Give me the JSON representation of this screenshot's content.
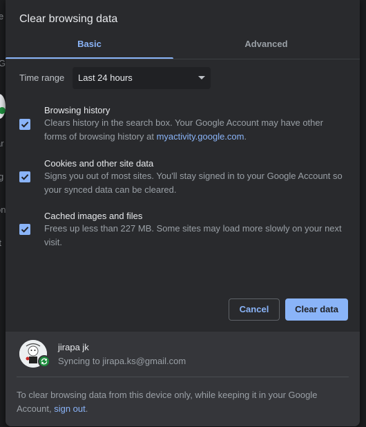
{
  "dialog": {
    "title": "Clear browsing data",
    "tabs": [
      {
        "label": "Basic",
        "selected": true
      },
      {
        "label": "Advanced",
        "selected": false
      }
    ],
    "time_range": {
      "label": "Time range",
      "value": "Last 24 hours"
    },
    "items": [
      {
        "title": "Browsing history",
        "checked": true,
        "desc_before": "Clears history in the search box. Your Google Account may have other forms of browsing history at ",
        "desc_link": "myactivity.google.com",
        "desc_after": "."
      },
      {
        "title": "Cookies and other site data",
        "checked": true,
        "desc": "Signs you out of most sites. You'll stay signed in to your Google Account so your synced data can be cleared."
      },
      {
        "title": "Cached images and files",
        "checked": true,
        "desc": "Frees up less than 227 MB. Some sites may load more slowly on your next visit."
      }
    ],
    "buttons": {
      "cancel": "Cancel",
      "clear": "Clear data"
    },
    "account": {
      "name": "jirapa jk",
      "sync_status": "Syncing to jirapa.ks@gmail.com"
    },
    "footer": {
      "note_before": "To clear browsing data from this device only, while keeping it in your Google Account, ",
      "link": "sign out",
      "note_after": "."
    }
  },
  "background": {
    "fragments": [
      "e",
      "G",
      "ar",
      "g",
      "on",
      "rt"
    ]
  },
  "colors": {
    "accent": "#8ab4f8",
    "dialog_bg": "#292a2d",
    "footer_bg": "#35363a",
    "sync_green": "#1e8e3e"
  },
  "icons": {
    "checkbox": "check-icon",
    "dropdown": "chevron-down-icon",
    "sync": "sync-icon"
  }
}
